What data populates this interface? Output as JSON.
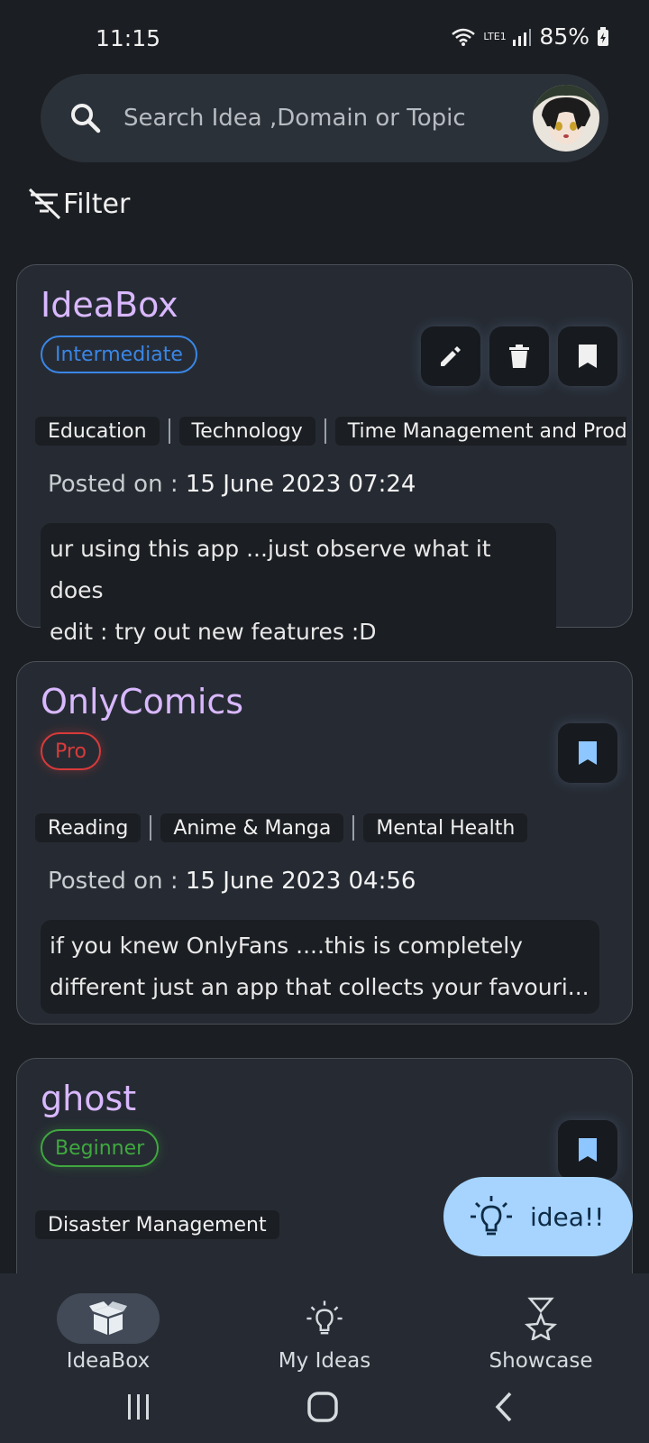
{
  "status_bar": {
    "time": "11:15",
    "battery": "85%",
    "network": "LTE1"
  },
  "search": {
    "placeholder": "Search Idea ,Domain or Topic"
  },
  "filter": {
    "label": "Filter"
  },
  "cards": [
    {
      "title": "IdeaBox",
      "level": "Intermediate",
      "level_color": "#3a86e6",
      "tags": [
        "Education",
        "Technology",
        "Time Management and Productivity"
      ],
      "posted_label": "Posted on : ",
      "posted_date": "15 June 2023  07:24",
      "description_line1": "ur using this app ...just observe what it does",
      "description_line2": "edit : try out new features :D"
    },
    {
      "title": "OnlyComics",
      "level": "Pro",
      "level_color": "#d83a3a",
      "tags": [
        "Reading",
        "Anime & Manga",
        "Mental Health"
      ],
      "posted_label": "Posted on : ",
      "posted_date": "15 June 2023  04:56",
      "description_line1": "if you knew OnlyFans ....this is completely",
      "description_line2": "different  just an app that collects your favouri..."
    },
    {
      "title": "ghost",
      "level": "Beginner",
      "level_color": "#3fa83f",
      "tags": [
        "Disaster Management"
      ]
    }
  ],
  "fab": {
    "label": "idea!!"
  },
  "bottom_nav": [
    {
      "label": "IdeaBox",
      "icon": "box-icon",
      "selected": true
    },
    {
      "label": "My Ideas",
      "icon": "lightbulb-icon",
      "selected": false
    },
    {
      "label": "Showcase",
      "icon": "trophy-icon",
      "selected": false
    }
  ]
}
